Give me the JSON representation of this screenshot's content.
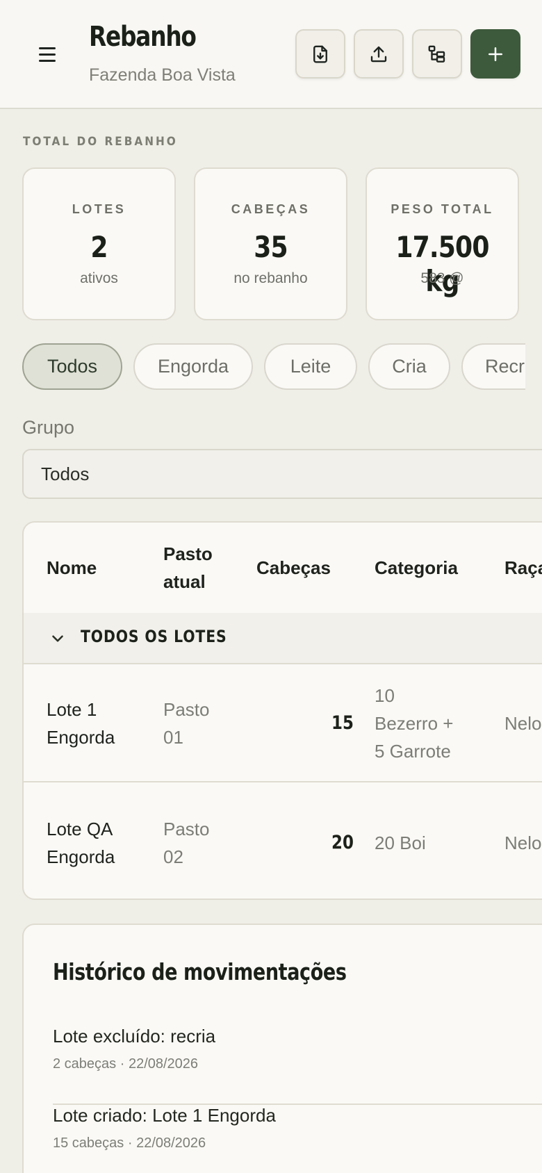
{
  "header": {
    "title": "Rebanho",
    "subtitle": "Fazenda Boa Vista",
    "icons": [
      "menu-icon",
      "file-download-icon",
      "upload-icon",
      "hierarchy-icon",
      "plus-icon"
    ],
    "accent_color": "#3d5a3c"
  },
  "summary": {
    "label": "TOTAL DO REBANHO",
    "stats": [
      {
        "label": "LOTES",
        "value": "2",
        "sub": "ativos"
      },
      {
        "label": "CABEÇAS",
        "value": "35",
        "sub": "no rebanho"
      },
      {
        "label": "PESO TOTAL",
        "value": "17.500 kg",
        "sub": "583 @"
      }
    ]
  },
  "filters": {
    "chips": [
      "Todos",
      "Engorda",
      "Leite",
      "Cria",
      "Recria"
    ],
    "active": "Todos"
  },
  "group_filter": {
    "label": "Grupo",
    "value": "Todos"
  },
  "table": {
    "columns": {
      "nome": "Nome",
      "pasto_l1": "Pasto",
      "pasto_l2": "atual",
      "cabecas": "Cabeças",
      "categoria": "Categoria",
      "raca": "Raça"
    },
    "group_title": "TODOS OS LOTES",
    "rows": [
      {
        "nome_l1": "Lote 1",
        "nome_l2": "Engorda",
        "pasto_l1": "Pasto",
        "pasto_l2": "01",
        "cabecas": "15",
        "categoria_l1": "10",
        "categoria_l2": "Bezerro +",
        "categoria_l3": "5 Garrote",
        "raca": "Nelore"
      },
      {
        "nome_l1": "Lote QA",
        "nome_l2": "Engorda",
        "pasto_l1": "Pasto",
        "pasto_l2": "02",
        "cabecas": "20",
        "categoria_l1": "20 Boi",
        "raca": "Nelore"
      }
    ]
  },
  "history": {
    "title": "Histórico de movimentações",
    "items": [
      {
        "title": "Lote excluído: recria",
        "meta": "2 cabeças · 22/08/2026"
      },
      {
        "title": "Lote criado: Lote 1 Engorda",
        "meta": "15 cabeças · 22/08/2026"
      }
    ]
  }
}
